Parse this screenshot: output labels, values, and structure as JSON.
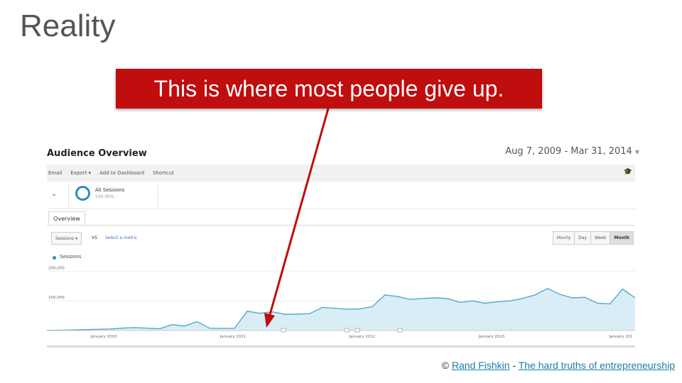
{
  "slide": {
    "title": "Reality"
  },
  "callout": {
    "text": "This is where most people give up."
  },
  "analytics": {
    "title": "Audience Overview",
    "date_range": "Aug 7, 2009 - Mar 31, 2014",
    "toolbar": [
      "Email",
      "Export ▾",
      "Add to Dashboard",
      "Shortcut"
    ],
    "segment": {
      "name": "All Sessions",
      "percent": "100.00%"
    },
    "tab": "Overview",
    "metric_select": "Sessions",
    "vs": "VS",
    "select_metric": "Select a metric",
    "granularity": {
      "options": [
        "Hourly",
        "Day",
        "Week",
        "Month"
      ],
      "selected": "Month"
    },
    "legend": "Sessions",
    "colors": {
      "line": "#54a9cc",
      "fill": "#d9edf6",
      "accent": "#2a8fbd",
      "callout": "#c00d0d"
    }
  },
  "chart_data": {
    "type": "area",
    "title": "",
    "ylabel": "",
    "xlabel": "",
    "x_tick_labels": [
      "January 2010",
      "January 2011",
      "January 2012",
      "January 2013",
      "January 201"
    ],
    "y_tick_labels": [
      "200,000",
      "100,000"
    ],
    "ylim": [
      0,
      220000
    ],
    "grid": true,
    "series": [
      {
        "name": "Sessions",
        "values": [
          500,
          1000,
          2000,
          3000,
          4000,
          5000,
          8000,
          10000,
          8000,
          6000,
          20000,
          15000,
          30000,
          8000,
          7000,
          8000,
          65000,
          58000,
          63000,
          55000,
          55000,
          57000,
          78000,
          75000,
          72000,
          73000,
          80000,
          120000,
          115000,
          105000,
          108000,
          110000,
          108000,
          95000,
          100000,
          92000,
          97000,
          100000,
          108000,
          120000,
          142000,
          122000,
          110000,
          112000,
          92000,
          90000,
          140000,
          110000
        ]
      }
    ]
  },
  "credit": {
    "symbol": "©",
    "author": "Rand Fishkin",
    "separator": "-",
    "source": "The hard truths of entrepreneurship"
  }
}
